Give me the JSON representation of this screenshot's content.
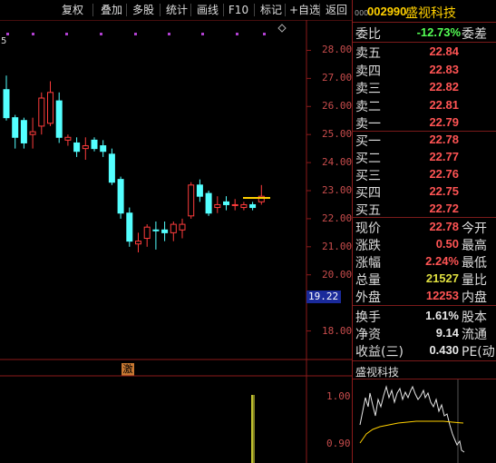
{
  "toolbar": {
    "items": [
      "复权",
      "叠加",
      "多股",
      "统计",
      "画线",
      "F10",
      "标记",
      "+自选",
      "返回"
    ]
  },
  "stock": {
    "code": "002990",
    "name": "盛视科技",
    "code_prefix": "000"
  },
  "chart": {
    "left_label": "5",
    "y_ticks": [
      "28.00",
      "27.00",
      "26.00",
      "25.00",
      "24.00",
      "23.00",
      "22.00",
      "21.00",
      "20.00",
      "19.22",
      "18.00"
    ],
    "cursor_price": "19.22",
    "marker_label": "激"
  },
  "chart_data": {
    "type": "candlestick",
    "ylim": [
      17.5,
      28.5
    ],
    "candles": [
      {
        "o": 26.6,
        "h": 27.1,
        "l": 25.5,
        "c": 25.6,
        "dir": "down"
      },
      {
        "o": 25.6,
        "h": 25.7,
        "l": 24.5,
        "c": 24.9,
        "dir": "down"
      },
      {
        "o": 24.7,
        "h": 25.6,
        "l": 24.5,
        "c": 25.5,
        "dir": "down"
      },
      {
        "o": 25.0,
        "h": 25.6,
        "l": 24.5,
        "c": 25.1,
        "dir": "up"
      },
      {
        "o": 25.3,
        "h": 26.5,
        "l": 25.0,
        "c": 26.3,
        "dir": "up"
      },
      {
        "o": 26.5,
        "h": 26.9,
        "l": 25.3,
        "c": 25.4,
        "dir": "up"
      },
      {
        "o": 26.2,
        "h": 26.5,
        "l": 24.7,
        "c": 24.9,
        "dir": "down"
      },
      {
        "o": 24.9,
        "h": 25.0,
        "l": 24.6,
        "c": 24.8,
        "dir": "up"
      },
      {
        "o": 24.7,
        "h": 24.9,
        "l": 24.2,
        "c": 24.4,
        "dir": "down"
      },
      {
        "o": 24.5,
        "h": 24.9,
        "l": 24.1,
        "c": 24.6,
        "dir": "up"
      },
      {
        "o": 24.8,
        "h": 24.9,
        "l": 24.4,
        "c": 24.5,
        "dir": "down"
      },
      {
        "o": 24.6,
        "h": 24.8,
        "l": 24.2,
        "c": 24.4,
        "dir": "down"
      },
      {
        "o": 24.3,
        "h": 24.5,
        "l": 23.2,
        "c": 23.3,
        "dir": "down"
      },
      {
        "o": 23.4,
        "h": 23.5,
        "l": 22.0,
        "c": 22.2,
        "dir": "down"
      },
      {
        "o": 22.2,
        "h": 22.4,
        "l": 21.0,
        "c": 21.2,
        "dir": "down"
      },
      {
        "o": 21.2,
        "h": 21.5,
        "l": 20.8,
        "c": 21.1,
        "dir": "up"
      },
      {
        "o": 21.3,
        "h": 21.8,
        "l": 21.0,
        "c": 21.7,
        "dir": "up"
      },
      {
        "o": 21.6,
        "h": 21.9,
        "l": 20.9,
        "c": 21.6,
        "dir": "down"
      },
      {
        "o": 21.6,
        "h": 21.9,
        "l": 21.2,
        "c": 21.5,
        "dir": "down"
      },
      {
        "o": 21.5,
        "h": 21.9,
        "l": 21.2,
        "c": 21.8,
        "dir": "up"
      },
      {
        "o": 21.6,
        "h": 22.0,
        "l": 21.3,
        "c": 21.8,
        "dir": "up"
      },
      {
        "o": 22.1,
        "h": 23.3,
        "l": 22.0,
        "c": 23.2,
        "dir": "up"
      },
      {
        "o": 23.2,
        "h": 23.4,
        "l": 22.6,
        "c": 22.8,
        "dir": "down"
      },
      {
        "o": 22.9,
        "h": 23.0,
        "l": 22.1,
        "c": 22.2,
        "dir": "down"
      },
      {
        "o": 22.4,
        "h": 22.8,
        "l": 22.2,
        "c": 22.5,
        "dir": "up"
      },
      {
        "o": 22.6,
        "h": 22.8,
        "l": 22.3,
        "c": 22.5,
        "dir": "down"
      },
      {
        "o": 22.5,
        "h": 22.7,
        "l": 22.3,
        "c": 22.5,
        "dir": "up"
      },
      {
        "o": 22.5,
        "h": 22.6,
        "l": 22.3,
        "c": 22.4,
        "dir": "up"
      },
      {
        "o": 22.5,
        "h": 22.6,
        "l": 22.3,
        "c": 22.4,
        "dir": "down"
      },
      {
        "o": 22.6,
        "h": 23.2,
        "l": 22.5,
        "c": 22.8,
        "dir": "up"
      }
    ],
    "volume_axis": [
      "1.00",
      "0.90"
    ]
  },
  "quote": {
    "ratio_label": "委比",
    "ratio_value": "-12.73%",
    "ratio_right": "委差",
    "asks": [
      {
        "label": "卖五",
        "price": "22.84"
      },
      {
        "label": "卖四",
        "price": "22.83"
      },
      {
        "label": "卖三",
        "price": "22.82"
      },
      {
        "label": "卖二",
        "price": "22.81"
      },
      {
        "label": "卖一",
        "price": "22.79"
      }
    ],
    "bids": [
      {
        "label": "买一",
        "price": "22.78"
      },
      {
        "label": "买二",
        "price": "22.77"
      },
      {
        "label": "买三",
        "price": "22.76"
      },
      {
        "label": "买四",
        "price": "22.75"
      },
      {
        "label": "买五",
        "price": "22.72"
      }
    ],
    "stats": [
      {
        "label": "现价",
        "value": "22.78",
        "right": "今开",
        "color": "red"
      },
      {
        "label": "涨跌",
        "value": "0.50",
        "right": "最高",
        "color": "red"
      },
      {
        "label": "涨幅",
        "value": "2.24%",
        "right": "最低",
        "color": "red"
      },
      {
        "label": "总量",
        "value": "21527",
        "right": "量比",
        "color": "yellow"
      },
      {
        "label": "外盘",
        "value": "12253",
        "right": "内盘",
        "color": "red"
      }
    ],
    "stats2": [
      {
        "label": "换手",
        "value": "1.61%",
        "right": "股本",
        "color": "white"
      },
      {
        "label": "净资",
        "value": "9.14",
        "right": "流通",
        "color": "white"
      },
      {
        "label": "收益(三)",
        "value": "0.430",
        "right": "PE(动",
        "color": "white"
      }
    ],
    "mini_title": "盛视科技"
  },
  "colors": {
    "up": "#ff3c3c",
    "down": "#54ffff",
    "axis": "#8b1a1a",
    "price_text": "#ff5454"
  }
}
